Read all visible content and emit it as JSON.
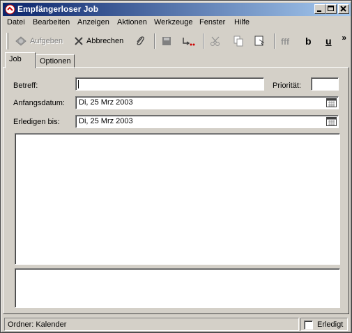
{
  "window": {
    "title": "Empfängerloser Job"
  },
  "menu": [
    "Datei",
    "Bearbeiten",
    "Anzeigen",
    "Aktionen",
    "Werkzeuge",
    "Fenster",
    "Hilfe"
  ],
  "toolbar": {
    "aufgeben": "Aufgeben",
    "abbrechen": "Abbrechen",
    "bold": "b",
    "underline": "u",
    "more": "»"
  },
  "tabs": {
    "job": "Job",
    "optionen": "Optionen"
  },
  "form": {
    "betreff_label": "Betreff:",
    "betreff_value": "",
    "prioritaet_label": "Priorität:",
    "prioritaet_value": "",
    "anfangsdatum_label": "Anfangsdatum:",
    "anfangsdatum_value": "Di, 25 Mrz 2003",
    "erledigen_label": "Erledigen bis:",
    "erledigen_value": "Di, 25 Mrz 2003"
  },
  "status": {
    "ordner": "Ordner: Kalender",
    "erledigt_label": "Erledigt",
    "erledigt_checked": false
  }
}
